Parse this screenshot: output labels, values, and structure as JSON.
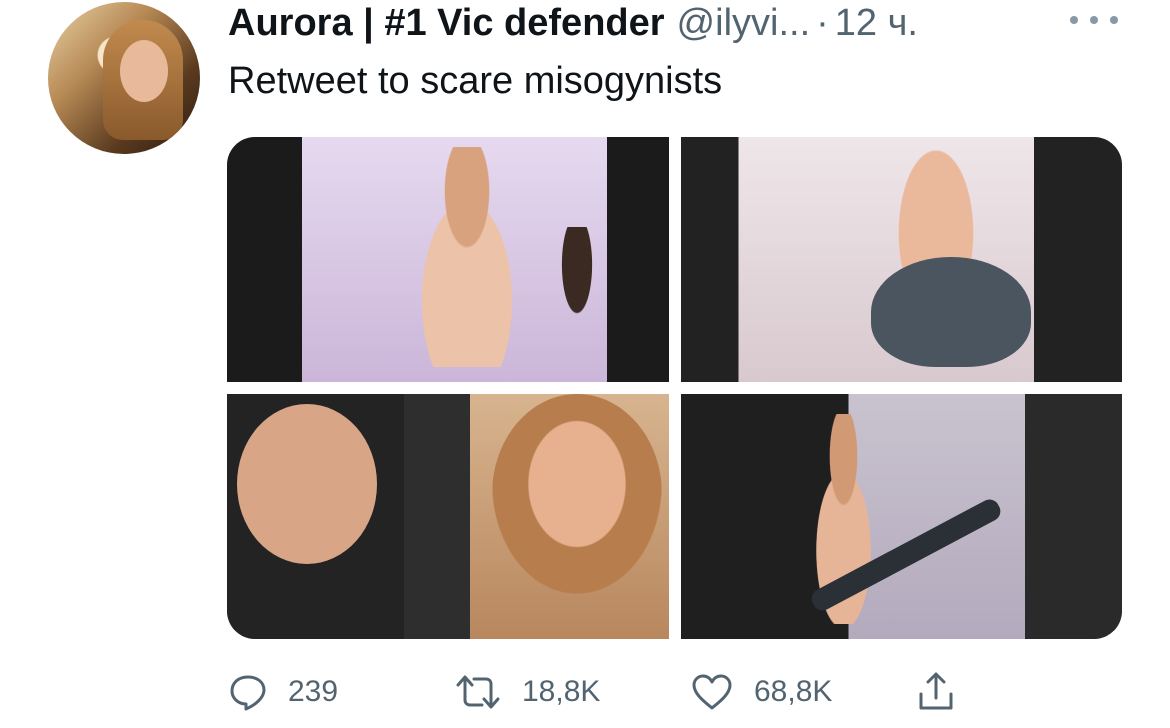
{
  "tweet": {
    "author_name": "Aurora | #1 Vic defender",
    "handle": "@ilyvi...",
    "separator": "·",
    "time": "12 ч.",
    "text": "Retweet to scare misogynists",
    "media_count": 4
  },
  "actions": {
    "reply_count": "239",
    "retweet_count": "18,8K",
    "like_count": "68,8K"
  },
  "icons": [
    "more-icon",
    "reply-icon",
    "retweet-icon",
    "like-icon",
    "share-icon"
  ],
  "colors": {
    "text": "#0f1419",
    "secondary": "#536471",
    "background": "#ffffff"
  }
}
